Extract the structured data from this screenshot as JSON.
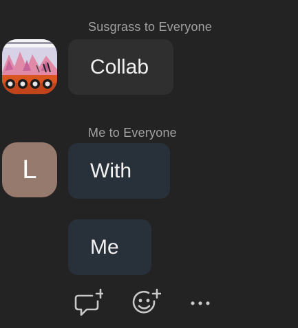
{
  "messages": [
    {
      "sender_line": "Susgrass to Everyone",
      "text": "Collab",
      "avatar": {
        "type": "image",
        "description_icon": "game-thumbnail"
      }
    },
    {
      "sender_line": "Me to Everyone",
      "text": "With",
      "avatar": {
        "type": "letter",
        "letter": "L"
      }
    },
    {
      "text": "Me"
    }
  ],
  "toolbar": {
    "reply_icon": "comment-add-icon",
    "reaction_icon": "emoji-add-icon",
    "more_icon": "more-options-icon"
  },
  "colors": {
    "background": "#232323",
    "bubble_other": "#2f2f2f",
    "bubble_mine": "#283039",
    "avatar_letter_bg": "#977a6e",
    "icon": "#c9c9c9"
  }
}
